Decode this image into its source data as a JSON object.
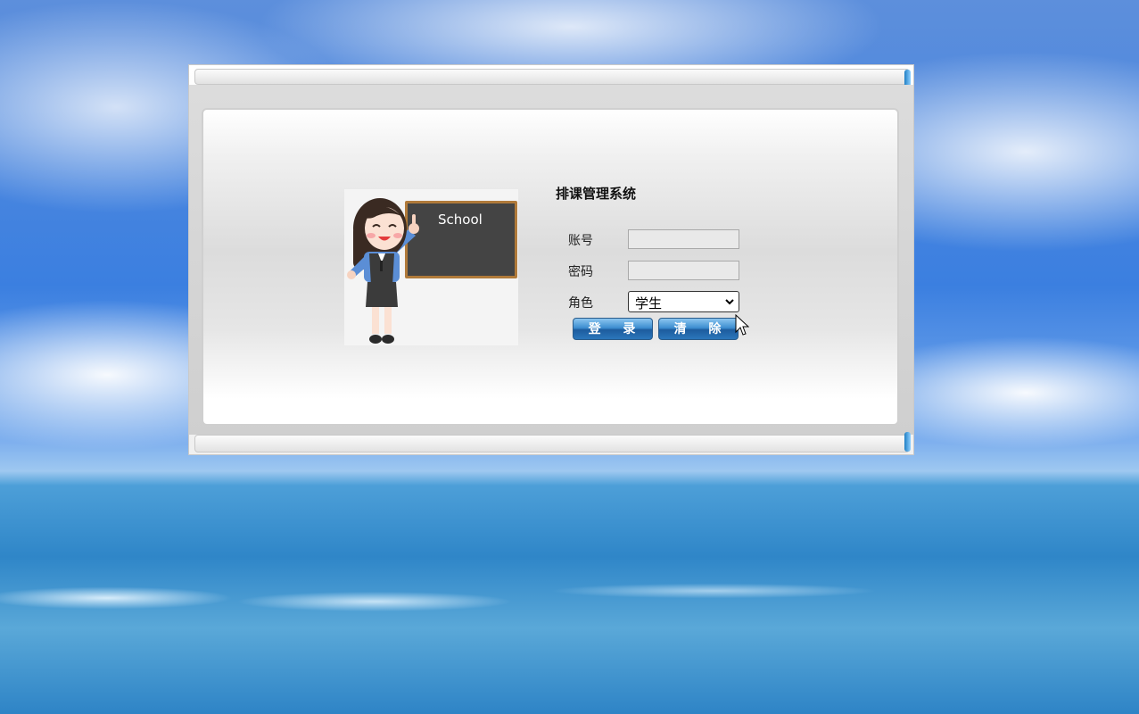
{
  "login": {
    "title": "排课管理系统",
    "account_label": "账号",
    "account_value": "",
    "password_label": "密码",
    "password_value": "",
    "role_label": "角色",
    "role_selected": "学生",
    "login_button": "登 录",
    "clear_button": "清 除"
  },
  "illustration": {
    "board_text": "School",
    "icon": "teacher-at-blackboard"
  },
  "colors": {
    "button_blue": "#2b77bb",
    "board": "#444444",
    "board_frame": "#b07a3a"
  }
}
